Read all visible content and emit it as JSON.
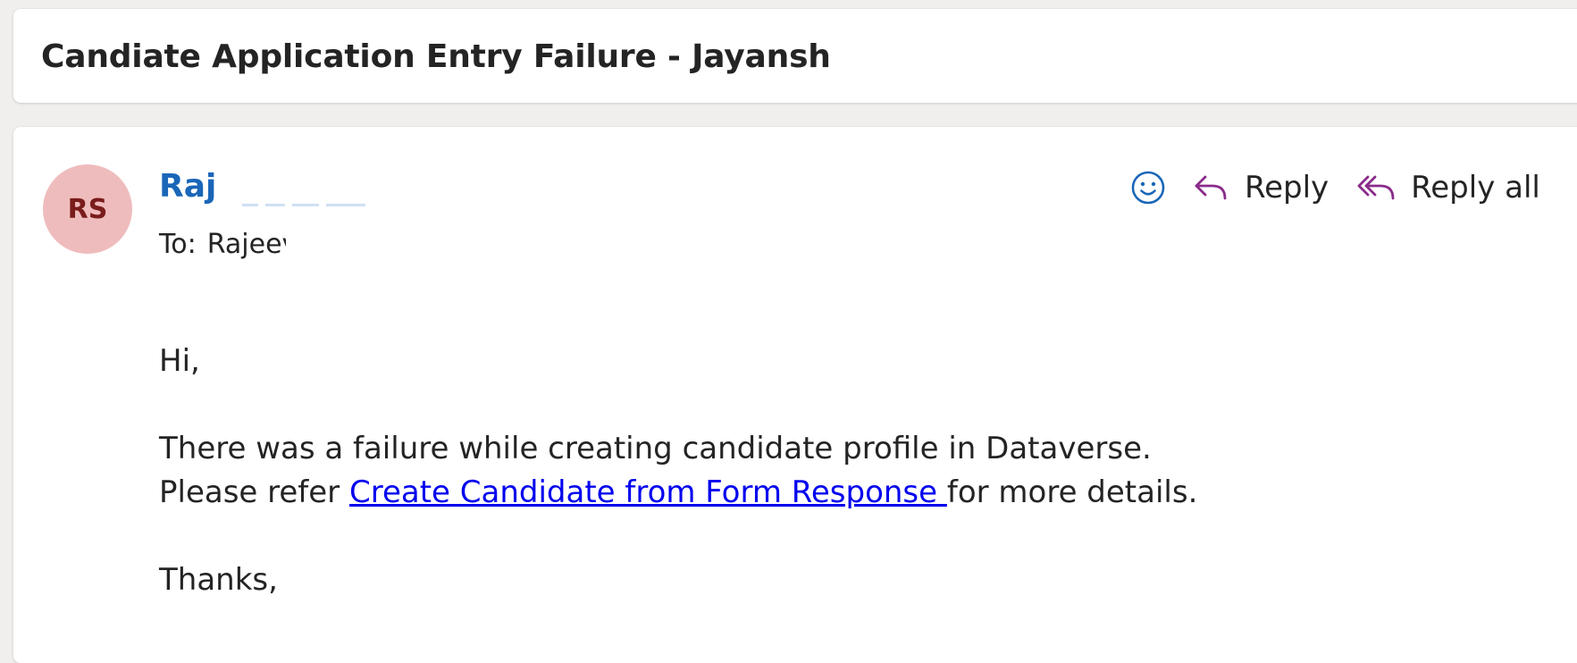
{
  "email": {
    "subject": "Candiate Application Entry Failure - Jayansh",
    "sender": {
      "initials": "RS",
      "name_visible": "Raj",
      "avatar_color": "#efbcbd",
      "avatar_text_color": "#7a1c1c",
      "name_color": "#1a66b8"
    },
    "to": {
      "label": "To:",
      "value_visible": "Rajeev"
    },
    "actions": {
      "emoji_icon": "smiley-icon",
      "reply_label": "Reply",
      "reply_all_label": "Reply all",
      "accent_color": "#8a2b8a"
    },
    "body": {
      "greeting": "Hi,",
      "line1": "There was a failure while creating candidate profile in Dataverse.",
      "line2_prefix": "Please refer ",
      "link_text": "Create Candidate from Form Response ",
      "line2_suffix": "for more details.",
      "signoff": "Thanks,"
    }
  }
}
